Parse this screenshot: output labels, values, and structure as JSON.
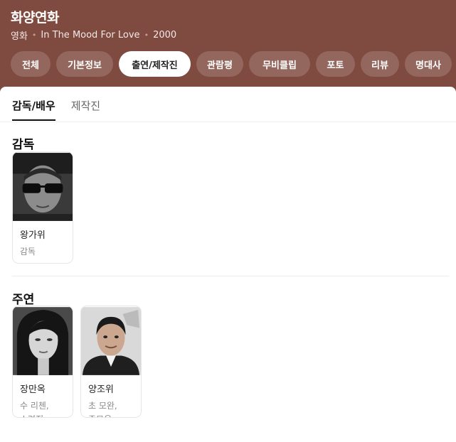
{
  "header": {
    "title": "화양연화",
    "meta": {
      "category": "영화",
      "original_title": "In The Mood For Love",
      "year": "2000"
    },
    "tabs": [
      {
        "label": "전체",
        "active": false
      },
      {
        "label": "기본정보",
        "active": false
      },
      {
        "label": "출연/제작진",
        "active": true
      },
      {
        "label": "관람평",
        "active": false
      },
      {
        "label": "무비클립",
        "active": false
      },
      {
        "label": "포토",
        "active": false
      },
      {
        "label": "리뷰",
        "active": false
      },
      {
        "label": "명대사",
        "active": false
      }
    ],
    "colors": {
      "background": "#7f4a3f",
      "active_tab": "#ffffff"
    }
  },
  "subtabs": [
    {
      "label": "감독/배우",
      "active": true
    },
    {
      "label": "제작진",
      "active": false
    }
  ],
  "directors": {
    "title": "감독",
    "people": [
      {
        "name": "왕가위",
        "role": [
          "감독"
        ],
        "photo_icon": "person-with-sunglasses-photo"
      }
    ]
  },
  "leads": {
    "title": "주연",
    "people": [
      {
        "name": "장만옥",
        "role": [
          "수 리첸,",
          "소려진, ..."
        ],
        "photo_icon": "woman-bw-portrait-photo"
      },
      {
        "name": "양조위",
        "role": [
          "초 모완,",
          "주모운, ..."
        ],
        "photo_icon": "man-suit-portrait-photo"
      }
    ]
  }
}
